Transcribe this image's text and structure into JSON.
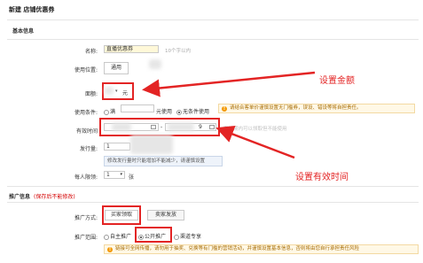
{
  "page": {
    "title": "新建 店铺优惠券"
  },
  "sections": {
    "basic": "基本信息",
    "promo": "推广信息",
    "promo_note": "(保存后不能修改)"
  },
  "form": {
    "name": {
      "label": "名称:",
      "value": "直播优惠券",
      "hint": "10个字以内"
    },
    "location": {
      "label": "使用位置:",
      "option": "通用"
    },
    "amount": {
      "label": "面额:",
      "unit": "元",
      "arrow": "▾"
    },
    "condition": {
      "label": "使用条件:",
      "opt1": "满",
      "opt1_suffix": "元使用",
      "opt2": "无条件使用",
      "warn": "请结合客单价谨慎设置无门槛券，误设、错设等将自担责任。"
    },
    "validity": {
      "label": "有效时间",
      "end_tail": "9",
      "note": "有效期内可以领取但不能使用"
    },
    "quantity": {
      "label": "发行量:",
      "value": "1",
      "tip": "修改发行量时只能增加不能减少，请谨慎设置"
    },
    "limit": {
      "label": "每人限领:",
      "value": "1",
      "arrow": "▾",
      "unit": "张"
    }
  },
  "promo": {
    "method": {
      "label": "推广方式:",
      "opt1": "买家领取",
      "opt2": "卖家发放"
    },
    "scope": {
      "label": "推广范围:",
      "opt1": "自主推广",
      "opt2": "公开推广",
      "opt3": "渠道专享"
    },
    "warn": "链接可全网传播，请勿用于抽奖、兑换等有门槛的营销活动，并谨慎设置基本信息，否则将由您自行承担责任风险"
  },
  "annotations": {
    "amount": "设置金额",
    "validity": "设置有效时间",
    "color": "#e32424"
  }
}
